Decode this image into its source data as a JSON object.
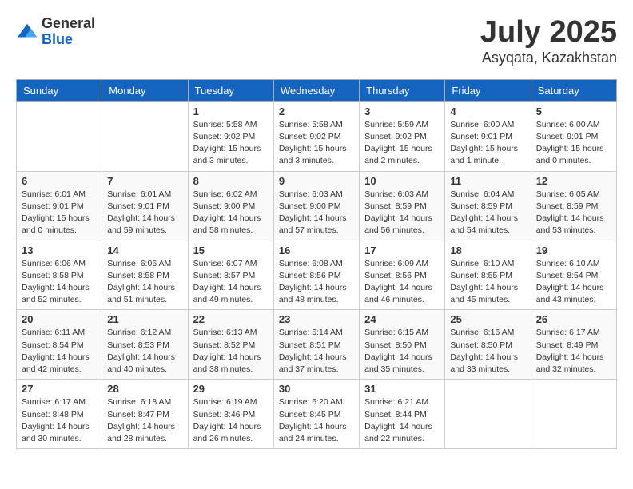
{
  "logo": {
    "general": "General",
    "blue": "Blue"
  },
  "title": "July 2025",
  "location": "Asyqata, Kazakhstan",
  "weekdays": [
    "Sunday",
    "Monday",
    "Tuesday",
    "Wednesday",
    "Thursday",
    "Friday",
    "Saturday"
  ],
  "weeks": [
    [
      {
        "day": "",
        "info": ""
      },
      {
        "day": "",
        "info": ""
      },
      {
        "day": "1",
        "info": "Sunrise: 5:58 AM\nSunset: 9:02 PM\nDaylight: 15 hours and 3 minutes."
      },
      {
        "day": "2",
        "info": "Sunrise: 5:58 AM\nSunset: 9:02 PM\nDaylight: 15 hours and 3 minutes."
      },
      {
        "day": "3",
        "info": "Sunrise: 5:59 AM\nSunset: 9:02 PM\nDaylight: 15 hours and 2 minutes."
      },
      {
        "day": "4",
        "info": "Sunrise: 6:00 AM\nSunset: 9:01 PM\nDaylight: 15 hours and 1 minute."
      },
      {
        "day": "5",
        "info": "Sunrise: 6:00 AM\nSunset: 9:01 PM\nDaylight: 15 hours and 0 minutes."
      }
    ],
    [
      {
        "day": "6",
        "info": "Sunrise: 6:01 AM\nSunset: 9:01 PM\nDaylight: 15 hours and 0 minutes."
      },
      {
        "day": "7",
        "info": "Sunrise: 6:01 AM\nSunset: 9:01 PM\nDaylight: 14 hours and 59 minutes."
      },
      {
        "day": "8",
        "info": "Sunrise: 6:02 AM\nSunset: 9:00 PM\nDaylight: 14 hours and 58 minutes."
      },
      {
        "day": "9",
        "info": "Sunrise: 6:03 AM\nSunset: 9:00 PM\nDaylight: 14 hours and 57 minutes."
      },
      {
        "day": "10",
        "info": "Sunrise: 6:03 AM\nSunset: 8:59 PM\nDaylight: 14 hours and 56 minutes."
      },
      {
        "day": "11",
        "info": "Sunrise: 6:04 AM\nSunset: 8:59 PM\nDaylight: 14 hours and 54 minutes."
      },
      {
        "day": "12",
        "info": "Sunrise: 6:05 AM\nSunset: 8:59 PM\nDaylight: 14 hours and 53 minutes."
      }
    ],
    [
      {
        "day": "13",
        "info": "Sunrise: 6:06 AM\nSunset: 8:58 PM\nDaylight: 14 hours and 52 minutes."
      },
      {
        "day": "14",
        "info": "Sunrise: 6:06 AM\nSunset: 8:58 PM\nDaylight: 14 hours and 51 minutes."
      },
      {
        "day": "15",
        "info": "Sunrise: 6:07 AM\nSunset: 8:57 PM\nDaylight: 14 hours and 49 minutes."
      },
      {
        "day": "16",
        "info": "Sunrise: 6:08 AM\nSunset: 8:56 PM\nDaylight: 14 hours and 48 minutes."
      },
      {
        "day": "17",
        "info": "Sunrise: 6:09 AM\nSunset: 8:56 PM\nDaylight: 14 hours and 46 minutes."
      },
      {
        "day": "18",
        "info": "Sunrise: 6:10 AM\nSunset: 8:55 PM\nDaylight: 14 hours and 45 minutes."
      },
      {
        "day": "19",
        "info": "Sunrise: 6:10 AM\nSunset: 8:54 PM\nDaylight: 14 hours and 43 minutes."
      }
    ],
    [
      {
        "day": "20",
        "info": "Sunrise: 6:11 AM\nSunset: 8:54 PM\nDaylight: 14 hours and 42 minutes."
      },
      {
        "day": "21",
        "info": "Sunrise: 6:12 AM\nSunset: 8:53 PM\nDaylight: 14 hours and 40 minutes."
      },
      {
        "day": "22",
        "info": "Sunrise: 6:13 AM\nSunset: 8:52 PM\nDaylight: 14 hours and 38 minutes."
      },
      {
        "day": "23",
        "info": "Sunrise: 6:14 AM\nSunset: 8:51 PM\nDaylight: 14 hours and 37 minutes."
      },
      {
        "day": "24",
        "info": "Sunrise: 6:15 AM\nSunset: 8:50 PM\nDaylight: 14 hours and 35 minutes."
      },
      {
        "day": "25",
        "info": "Sunrise: 6:16 AM\nSunset: 8:50 PM\nDaylight: 14 hours and 33 minutes."
      },
      {
        "day": "26",
        "info": "Sunrise: 6:17 AM\nSunset: 8:49 PM\nDaylight: 14 hours and 32 minutes."
      }
    ],
    [
      {
        "day": "27",
        "info": "Sunrise: 6:17 AM\nSunset: 8:48 PM\nDaylight: 14 hours and 30 minutes."
      },
      {
        "day": "28",
        "info": "Sunrise: 6:18 AM\nSunset: 8:47 PM\nDaylight: 14 hours and 28 minutes."
      },
      {
        "day": "29",
        "info": "Sunrise: 6:19 AM\nSunset: 8:46 PM\nDaylight: 14 hours and 26 minutes."
      },
      {
        "day": "30",
        "info": "Sunrise: 6:20 AM\nSunset: 8:45 PM\nDaylight: 14 hours and 24 minutes."
      },
      {
        "day": "31",
        "info": "Sunrise: 6:21 AM\nSunset: 8:44 PM\nDaylight: 14 hours and 22 minutes."
      },
      {
        "day": "",
        "info": ""
      },
      {
        "day": "",
        "info": ""
      }
    ]
  ]
}
